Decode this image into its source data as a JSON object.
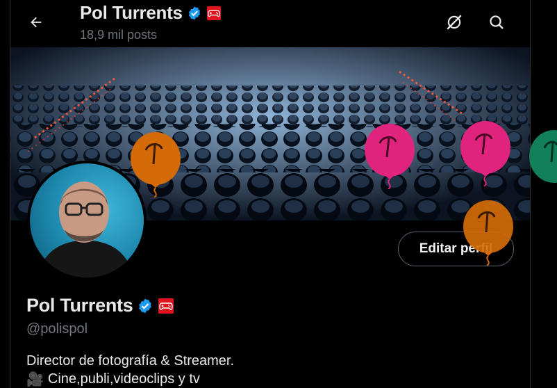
{
  "header": {
    "name": "Pol Turrents",
    "post_count": "18,9 mil posts"
  },
  "profile": {
    "name": "Pol Turrents",
    "handle": "@polispol",
    "bio_line1": "Director de fotografía & Streamer.",
    "bio_line2_emoji": "🎥",
    "bio_line2": "Cine,publi,videoclips y tv"
  },
  "actions": {
    "edit_profile": "Editar perfil"
  },
  "colors": {
    "verified": "#1d9bf0",
    "game_badge": "#e0141e",
    "balloon_orange": "#d46b08",
    "balloon_pink": "#e0247d",
    "balloon_green": "#12805a"
  },
  "icons": {
    "back": "arrow-left-icon",
    "grok": "grok-icon",
    "search": "search-icon",
    "verified": "verified-badge-icon",
    "game": "game-controller-icon",
    "camera": "movie-camera-icon"
  }
}
